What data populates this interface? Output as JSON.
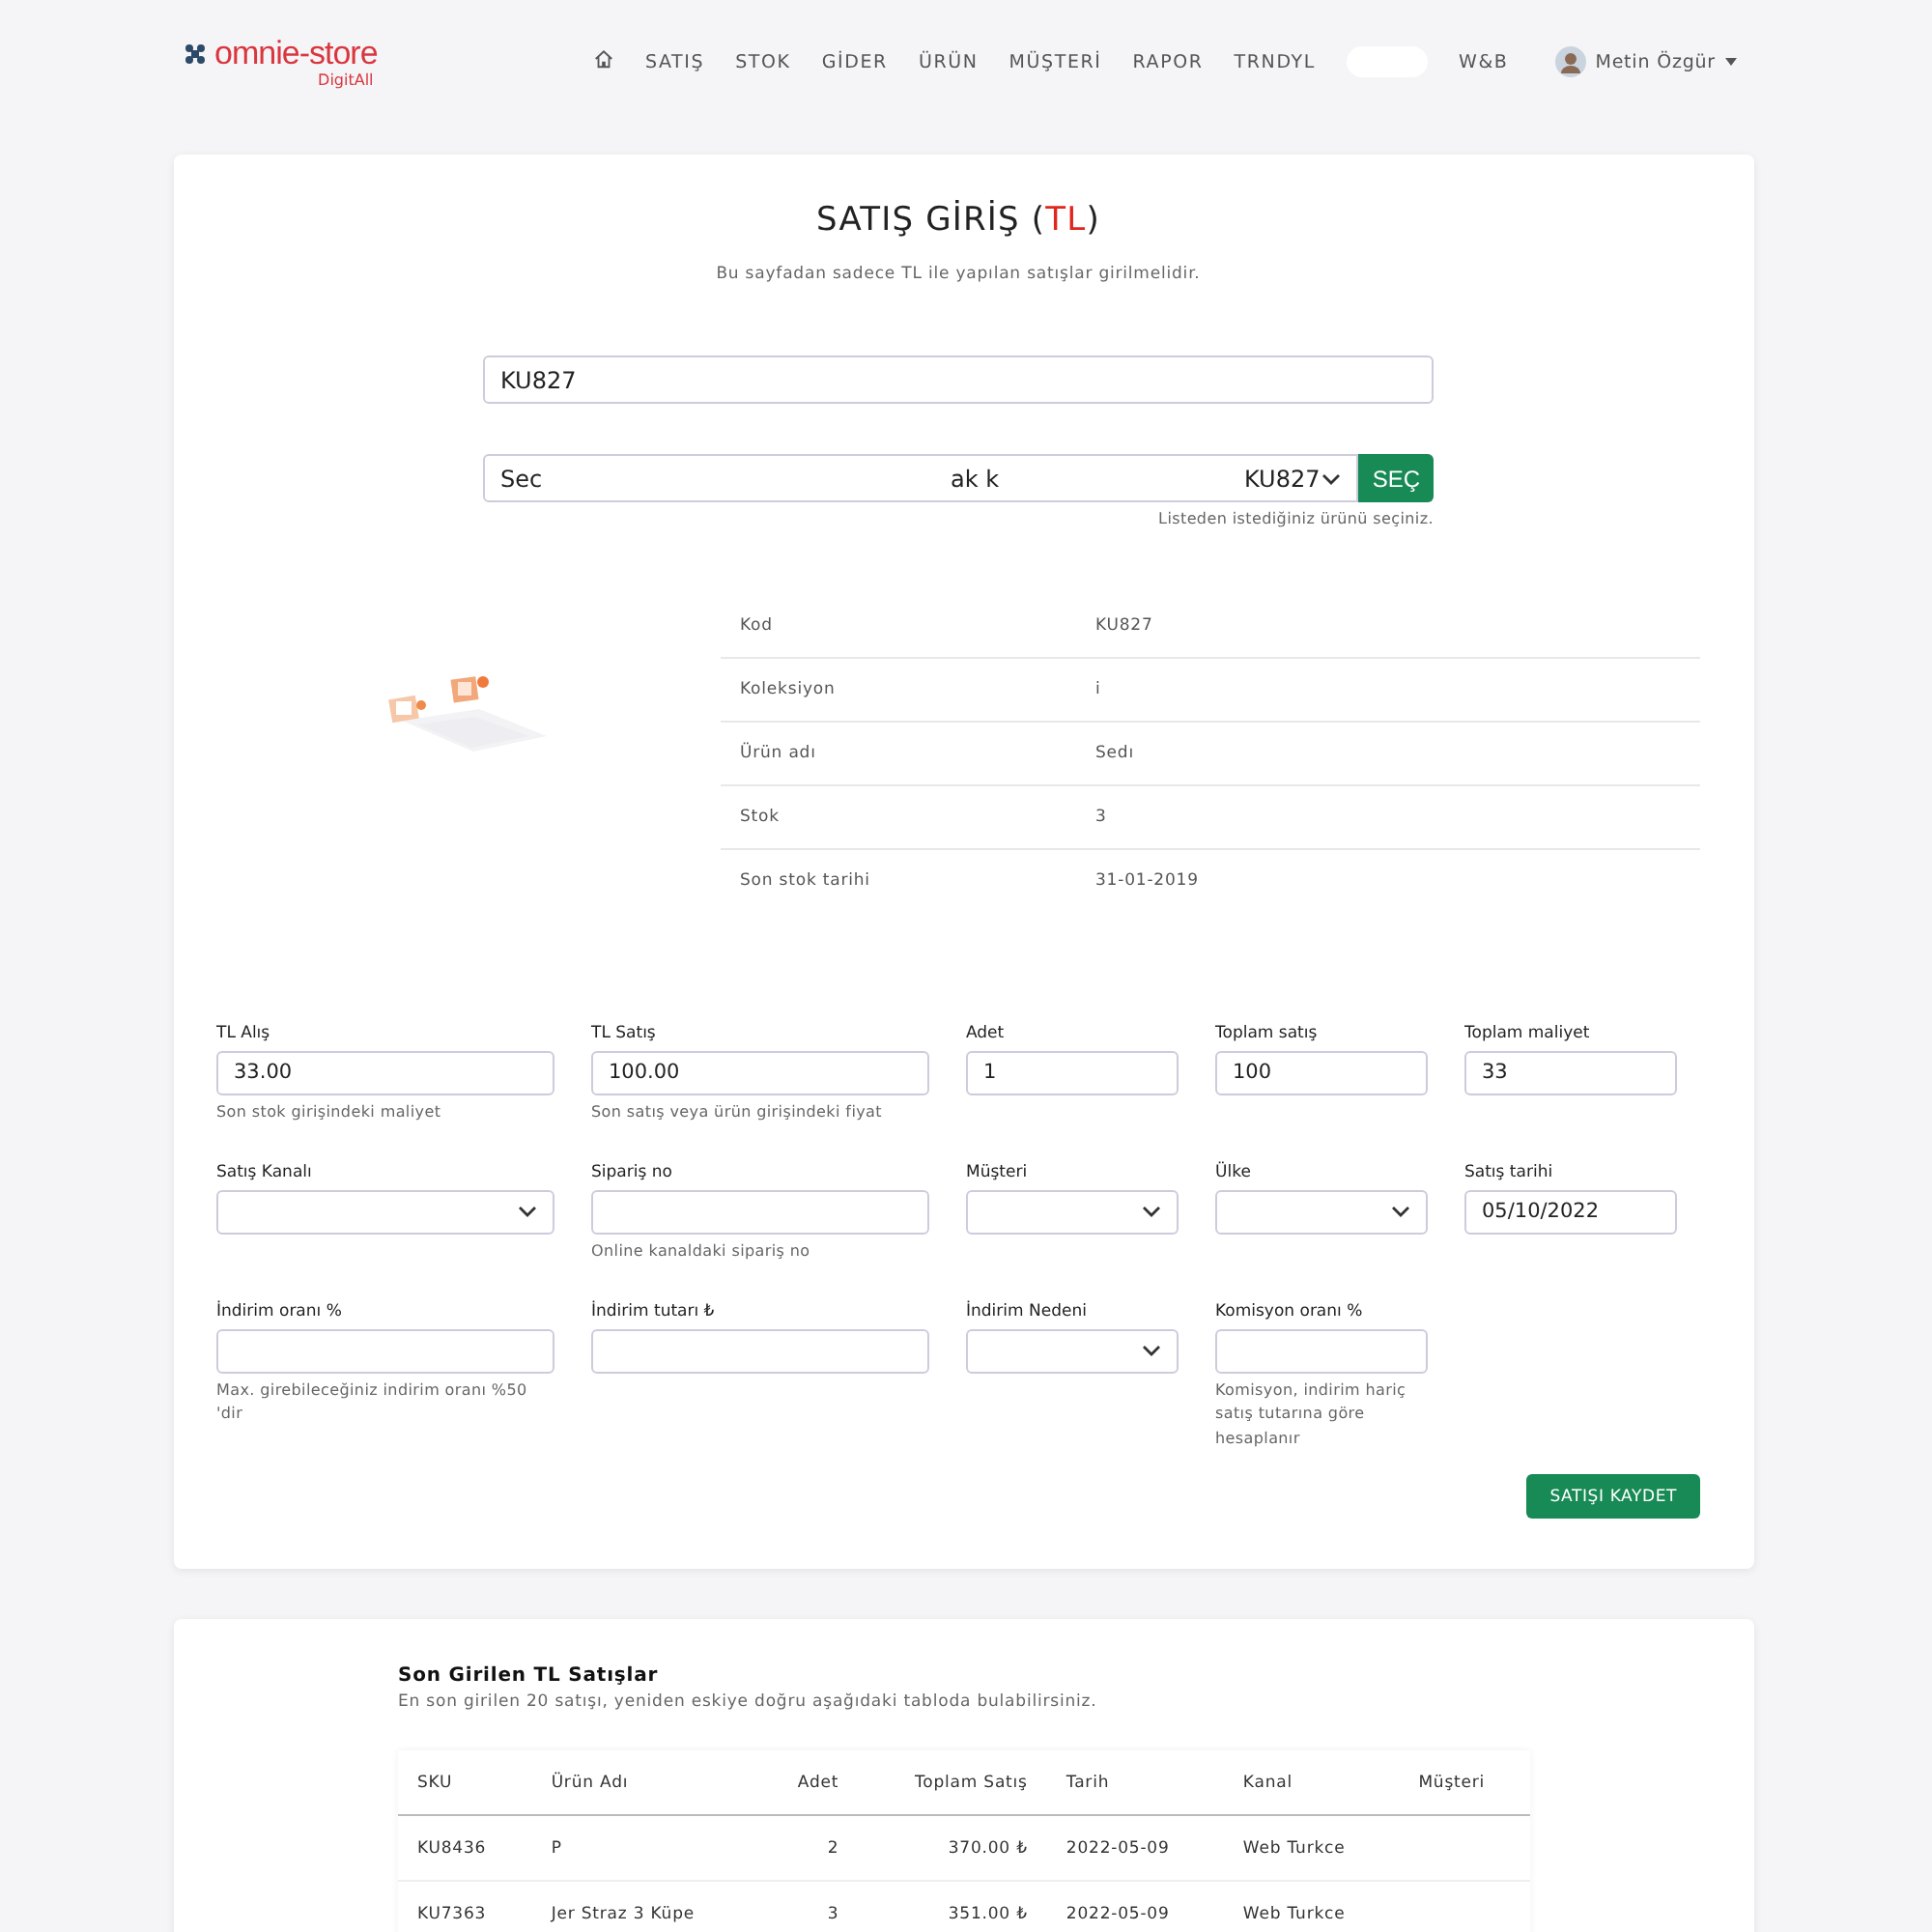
{
  "header": {
    "logo": {
      "brand_main": "omni",
      "brand_accent": "e-store",
      "sub": "DigitAll"
    },
    "nav": [
      {
        "kind": "home"
      },
      {
        "kind": "text",
        "label": "SATIŞ"
      },
      {
        "kind": "text",
        "label": "STOK"
      },
      {
        "kind": "text",
        "label": "GİDER"
      },
      {
        "kind": "text",
        "label": "ÜRÜN"
      },
      {
        "kind": "text",
        "label": "MÜŞTERİ"
      },
      {
        "kind": "text",
        "label": "RAPOR"
      },
      {
        "kind": "text",
        "label": "TRNDYL"
      },
      {
        "kind": "blank"
      },
      {
        "kind": "text",
        "label": "W&B"
      }
    ],
    "user": {
      "name": "Metin Özgür"
    }
  },
  "entry": {
    "title": "SATIŞ GİRİŞ (",
    "title_accent": "TL",
    "title_end": ")",
    "subtitle": "Bu sayfadan sadece TL ile yapılan satışlar girilmelidir.",
    "search": {
      "value": "KU827"
    },
    "product_select": {
      "value_parts": [
        "Sec",
        "ak k",
        "KU827"
      ],
      "button": "SEÇ",
      "help": "Listeden istediğiniz ürünü seçiniz."
    },
    "product": {
      "details": [
        {
          "label": "Kod",
          "value": "KU827"
        },
        {
          "label": "Koleksiyon",
          "value": "i"
        },
        {
          "label": "Ürün adı",
          "value": "Sedı"
        },
        {
          "label": "Stok",
          "value": "3"
        },
        {
          "label": "Son stok tarihi",
          "value": "31-01-2019"
        }
      ]
    },
    "fields": [
      {
        "kind": "input",
        "label": "TL Alış",
        "value": "33.00",
        "help": "Son stok girişindeki maliyet"
      },
      {
        "kind": "input",
        "label": "TL Satış",
        "value": "100.00",
        "help": "Son satış veya ürün girişindeki fiyat"
      },
      {
        "kind": "input",
        "label": "Adet",
        "value": "1"
      },
      {
        "kind": "input",
        "label": "Toplam satış",
        "value": "100"
      },
      {
        "kind": "input",
        "label": "Toplam maliyet",
        "value": "33"
      },
      {
        "kind": "select",
        "label": "Satış Kanalı"
      },
      {
        "kind": "input",
        "label": "Sipariş no",
        "help": "Online kanaldaki sipariş no"
      },
      {
        "kind": "select",
        "label": "Müşteri"
      },
      {
        "kind": "select",
        "label": "Ülke"
      },
      {
        "kind": "input",
        "label": "Satış tarihi",
        "value": "05/10/2022"
      },
      {
        "kind": "input",
        "label": "İndirim oranı %",
        "help": "Max. girebileceğiniz indirim oranı %50 'dir"
      },
      {
        "kind": "input",
        "label": "İndirim tutarı ₺"
      },
      {
        "kind": "select",
        "label": "İndirim Nedeni"
      },
      {
        "kind": "input",
        "label": "Komisyon oranı %",
        "help": "Komisyon, indirim hariç satış tutarına göre hesaplanır"
      }
    ],
    "save_button": "SATIŞI KAYDET"
  },
  "recent": {
    "title": "Son Girilen TL Satışlar",
    "subtitle": "En son girilen 20 satışı, yeniden eskiye doğru aşağıdaki tabloda bulabilirsiniz.",
    "table": {
      "columns": [
        "SKU",
        "Ürün Adı",
        "Adet",
        "Toplam Satış",
        "Tarih",
        "Kanal",
        "Müşteri"
      ],
      "rows": [
        [
          "KU8436",
          "P",
          "2",
          "370.00 ₺",
          "2022-05-09",
          "Web Turkce",
          ""
        ],
        [
          "KU7363",
          "Jer Straz 3 Küpe",
          "3",
          "351.00 ₺",
          "2022-05-09",
          "Web Turkce",
          ""
        ]
      ]
    }
  }
}
